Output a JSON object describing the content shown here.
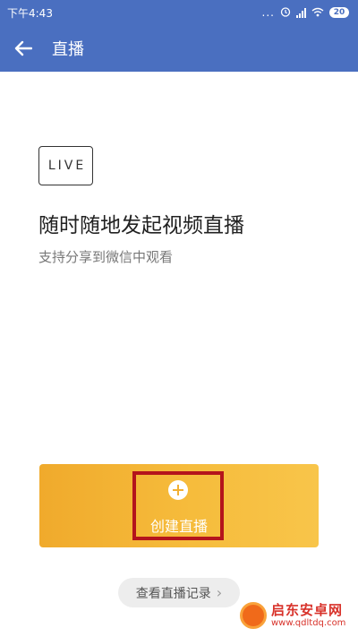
{
  "status_bar": {
    "time": "下午4:43",
    "dots": "...",
    "alarm_icon": "alarm-icon",
    "signal_icon": "signal-icon",
    "wifi_icon": "wifi-icon",
    "battery_level": "20"
  },
  "app_bar": {
    "back_icon": "arrow-left-icon",
    "title": "直播"
  },
  "hero": {
    "logo_text": "LIVE",
    "headline": "随时随地发起视频直播",
    "subline": "支持分享到微信中观看"
  },
  "create_card": {
    "icon": "plus-icon",
    "label": "创建直播",
    "highlight_color": "#b4141c",
    "accent_color": "#f4b335"
  },
  "history": {
    "label": "查看直播记录",
    "chevron": "›"
  },
  "watermark": {
    "title": "启东安卓网",
    "url": "www.qdltdq.com"
  },
  "colors": {
    "primary": "#4a6fc0",
    "background": "#ffffff"
  }
}
